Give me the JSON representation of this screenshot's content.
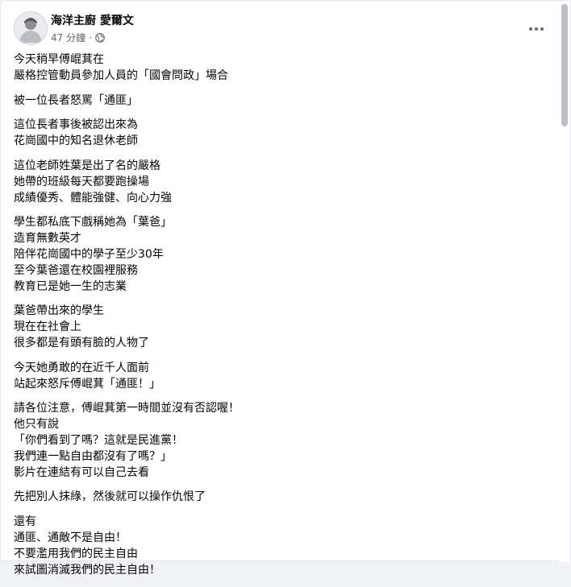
{
  "post": {
    "author": "海洋主廚 愛爾文",
    "time": "47 分鐘",
    "privacy_icon": "globe-icon",
    "more_icon": "more-options-icon"
  },
  "paragraphs": [
    [
      "今天稍早傅崐萁在",
      "嚴格控管動員參加人員的「國會問政」場合"
    ],
    [
      "被一位長者怒罵「通匪」"
    ],
    [
      "這位長者事後被認出來為",
      "花崗國中的知名退休老師"
    ],
    [
      "這位老師姓葉是出了名的嚴格",
      "她帶的班級每天都要跑操場",
      "成績優秀、體能強健、向心力強"
    ],
    [
      "學生都私底下戲稱她為「葉爸」",
      "造育無數英才",
      "陪伴花崗國中的學子至少30年",
      "至今葉爸還在校園裡服務",
      "教育已是她一生的志業"
    ],
    [
      "葉爸帶出來的學生",
      "現在在社會上",
      "很多都是有頭有臉的人物了"
    ],
    [
      "今天她勇敢的在近千人面前",
      "站起來怒斥傅崐萁「通匪！」"
    ],
    [
      "請各位注意，傅崐萁第一時間並沒有否認喔！",
      "他只有說",
      "「你們看到了嗎？這就是民進黨！",
      "我們連一點自由都沒有了嗎？」",
      "影片在連結有可以自己去看"
    ],
    [
      "先把別人抹綠，然後就可以操作仇恨了"
    ],
    [
      "還有",
      "通匪、通敵不是自由！",
      "不要濫用我們的民主自由",
      "來試圖消滅我們的民主自由！"
    ]
  ]
}
